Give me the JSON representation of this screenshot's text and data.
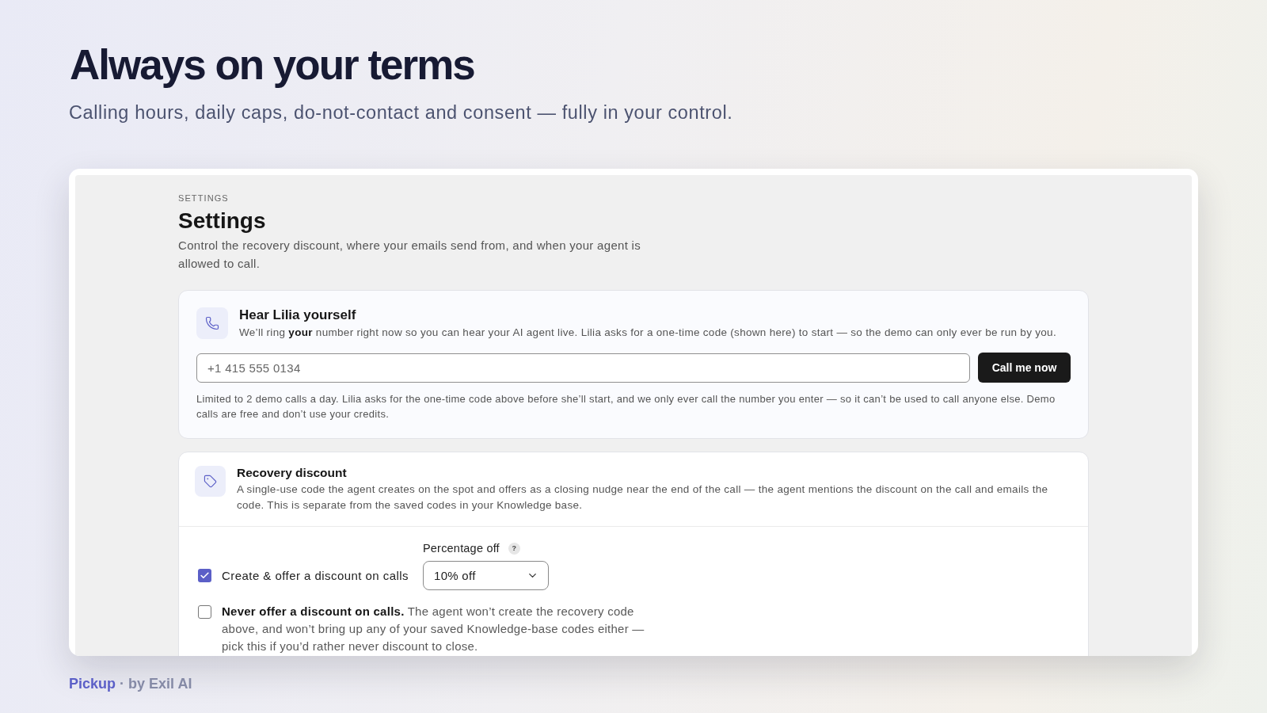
{
  "hero": {
    "title": "Always on your terms",
    "subtitle": "Calling hours, daily caps, do-not-contact and consent — fully in your control."
  },
  "settings": {
    "eyebrow": "SETTINGS",
    "title": "Settings",
    "description": "Control the recovery discount, where your emails send from, and when your agent is allowed to call."
  },
  "demo_call": {
    "title": "Hear Lilia yourself",
    "description": "We’ll ring **your** number right now so you can hear your AI agent live. Lilia asks for a one-time code (shown here) to start — so the demo can only ever be run by you.",
    "phone_field": {
      "placeholder": "+1 415 555 0134"
    },
    "button": "Call me now",
    "note": "Limited to 2 demo calls a day. Lilia asks for the one-time code above before she’ll start, and we only ever call the number you enter — so it can’t be used to call anyone else. Demo calls are free and don’t use your credits."
  },
  "recovery_discount": {
    "title": "Recovery discount",
    "description": "A single-use code the agent creates on the spot and offers as a closing nudge near the end of the call — the agent mentions the discount on the call and emails the code. This is separate from the saved codes in your Knowledge base.",
    "options": [
      {
        "kind": "checkbox",
        "label": "Create & offer a discount on calls",
        "checked": true,
        "percentage": {
          "label": "Percentage off",
          "help": "?",
          "value": "10% off"
        }
      },
      {
        "kind": "checkbox",
        "label": "**Never offer a discount on calls.** The agent won’t create the recovery code above, and won’t bring up any of your saved Knowledge-base codes either — pick this if you’d rather never discount to close.",
        "checked": false
      }
    ]
  },
  "footer": {
    "brand": "Pickup",
    "byline": "· by Exil AI"
  }
}
